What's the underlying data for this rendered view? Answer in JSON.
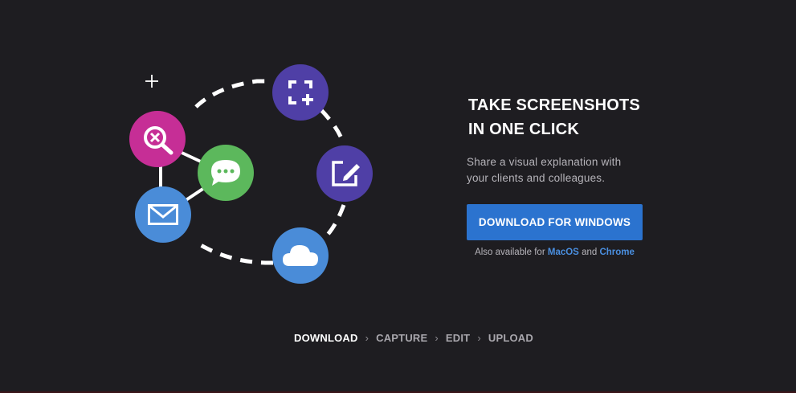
{
  "hero": {
    "title_line1": "TAKE SCREENSHOTS",
    "title_line2": "IN ONE CLICK",
    "subtitle_line1": "Share a visual explanation with",
    "subtitle_line2": "your clients and colleagues."
  },
  "download_button": {
    "label": "DOWNLOAD FOR WINDOWS"
  },
  "also_available": {
    "prefix": "Also available for",
    "link_macos": "MacOS",
    "conjunction": "and",
    "link_chrome": "Chrome"
  },
  "steps": [
    {
      "label": "DOWNLOAD",
      "active": true
    },
    {
      "label": "CAPTURE",
      "active": false
    },
    {
      "label": "EDIT",
      "active": false
    },
    {
      "label": "UPLOAD",
      "active": false
    }
  ],
  "icons": {
    "magnifier_reject": {
      "name": "zoom-reject-icon",
      "color": "#c62e96"
    },
    "chat": {
      "name": "chat-bubble-icon",
      "color": "#5cb85c"
    },
    "mail": {
      "name": "mail-icon",
      "color": "#4a8cd8"
    },
    "capture": {
      "name": "capture-add-icon",
      "color": "#4f3fa6"
    },
    "edit": {
      "name": "edit-icon",
      "color": "#4f3fa6"
    },
    "cloud": {
      "name": "cloud-icon",
      "color": "#4a8cd8"
    }
  },
  "colors": {
    "background": "#1e1d21",
    "accent": "#2b73cf",
    "link": "#4a8fe0"
  }
}
